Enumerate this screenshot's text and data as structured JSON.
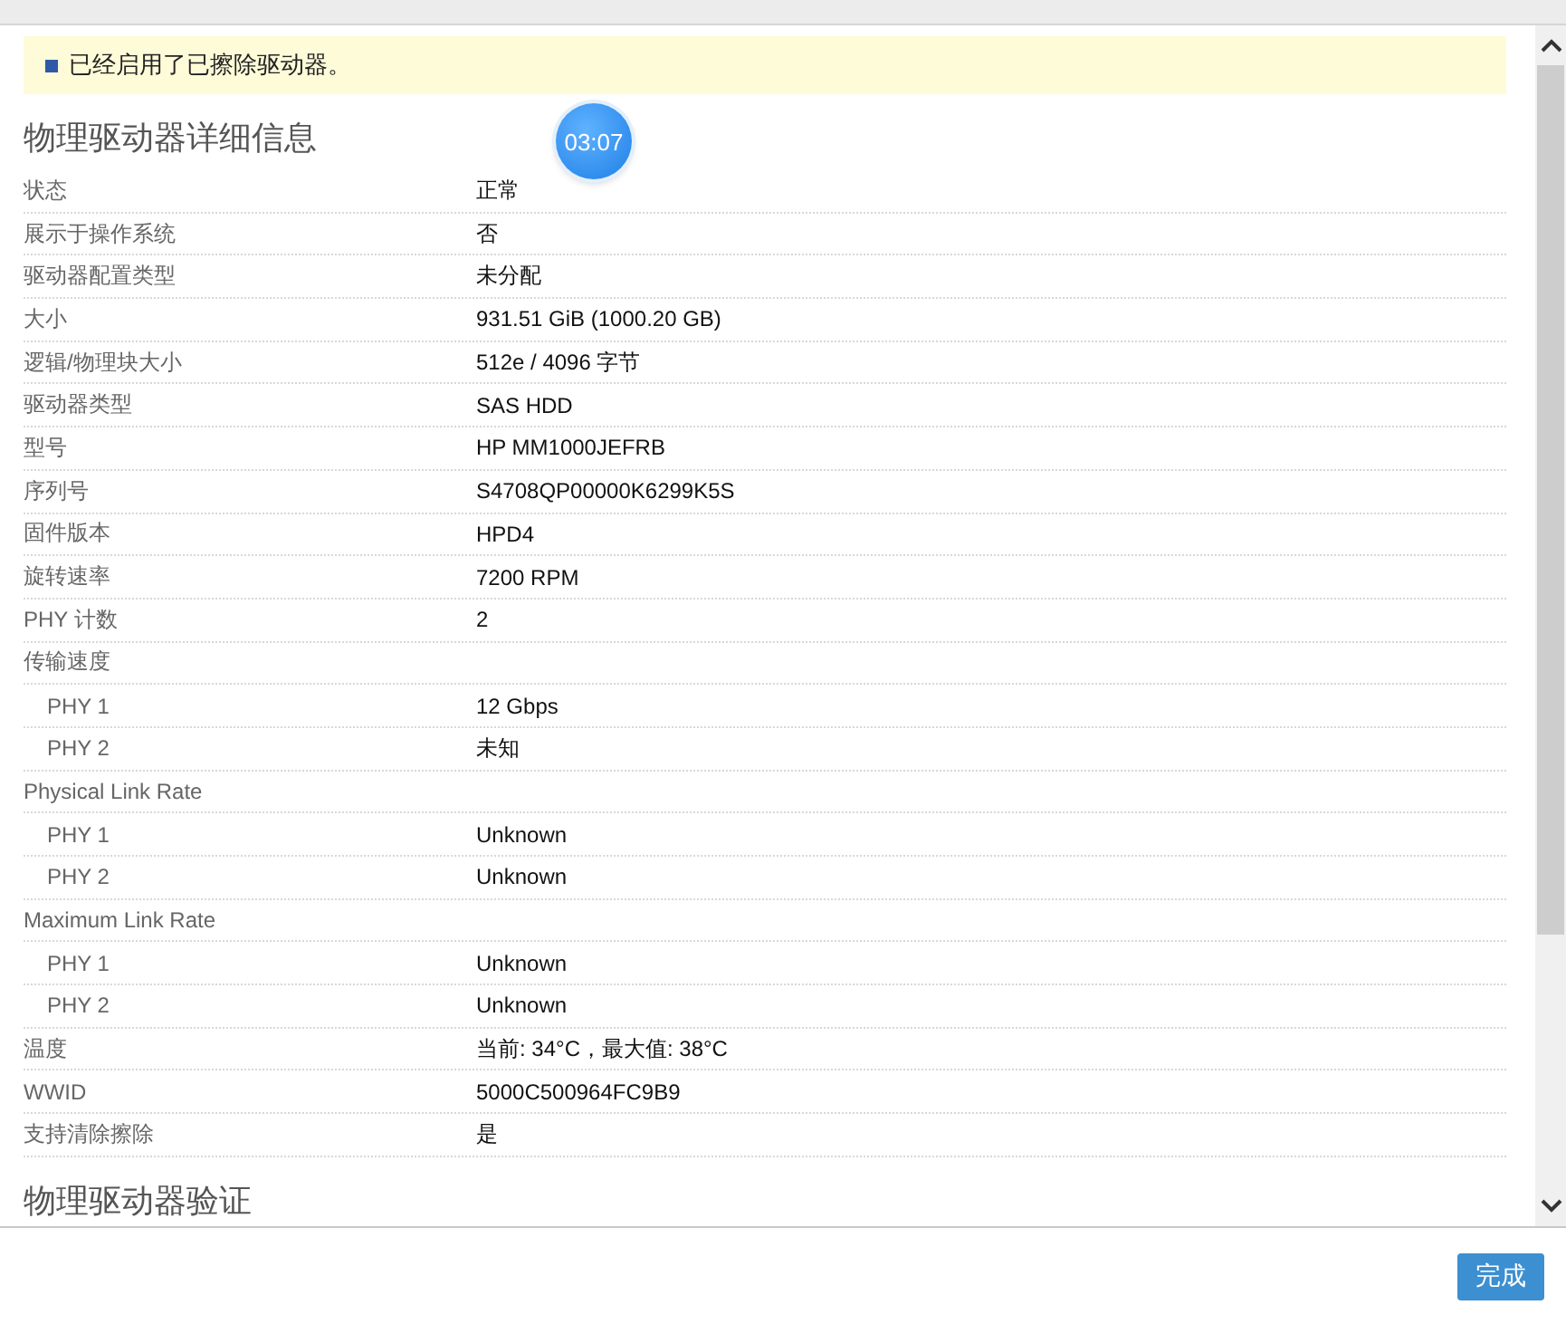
{
  "notice": {
    "text": "已经启用了已擦除驱动器。"
  },
  "timer": {
    "text": "03:07"
  },
  "section_title": "物理驱动器详细信息",
  "details": [
    {
      "label": "状态",
      "value": "正常"
    },
    {
      "label": "展示于操作系统",
      "value": "否"
    },
    {
      "label": "驱动器配置类型",
      "value": "未分配"
    },
    {
      "label": "大小",
      "value": "931.51 GiB (1000.20 GB)"
    },
    {
      "label": "逻辑/物理块大小",
      "value": "512e / 4096 字节"
    },
    {
      "label": "驱动器类型",
      "value": "SAS HDD"
    },
    {
      "label": "型号",
      "value": "HP MM1000JEFRB"
    },
    {
      "label": "序列号",
      "value": "S4708QP00000K6299K5S"
    },
    {
      "label": "固件版本",
      "value": "HPD4"
    },
    {
      "label": "旋转速率",
      "value": "7200 RPM"
    },
    {
      "label": "PHY 计数",
      "value": "2"
    },
    {
      "label": "传输速度",
      "children": [
        {
          "label": "PHY 1",
          "value": "12 Gbps"
        },
        {
          "label": "PHY 2",
          "value": "未知"
        }
      ]
    },
    {
      "label": "Physical Link Rate",
      "children": [
        {
          "label": "PHY 1",
          "value": "Unknown"
        },
        {
          "label": "PHY 2",
          "value": "Unknown"
        }
      ]
    },
    {
      "label": "Maximum Link Rate",
      "children": [
        {
          "label": "PHY 1",
          "value": "Unknown"
        },
        {
          "label": "PHY 2",
          "value": "Unknown"
        }
      ]
    },
    {
      "label": "温度",
      "value": "当前: 34°C，最大值: 38°C"
    },
    {
      "label": "WWID",
      "value": "5000C500964FC9B9"
    },
    {
      "label": "支持清除擦除",
      "value": "是"
    }
  ],
  "next_section_title": "物理驱动器验证",
  "footer": {
    "done_button": "完成"
  }
}
